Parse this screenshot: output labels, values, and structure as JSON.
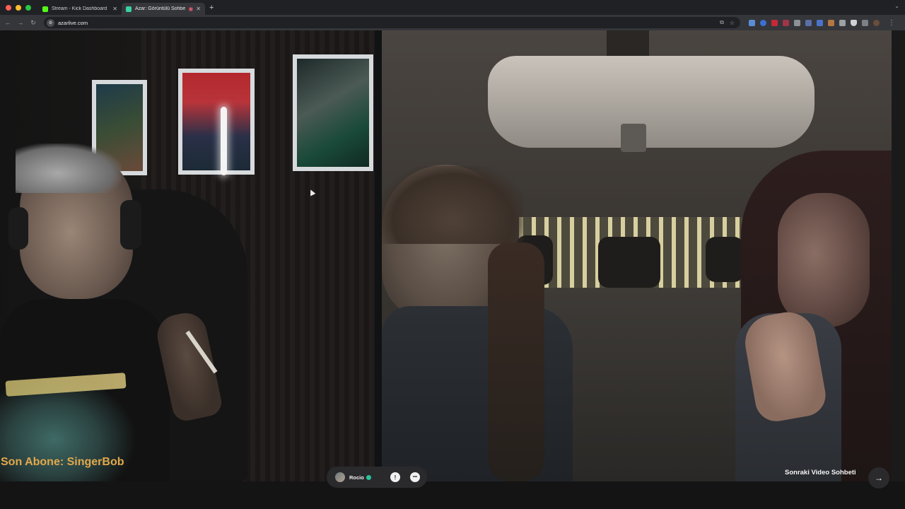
{
  "browser": {
    "tabs": [
      {
        "label": "Stream - Kick Dashboard",
        "favicon_color": "#53fc18"
      },
      {
        "label": "Azar: Görüntülü Sohbet &",
        "favicon_color": "#3ad29f"
      }
    ],
    "url": "azarlive.com"
  },
  "overlay": {
    "last_sub": "Son Abone: SingerBob"
  },
  "chat": {
    "partner_name": "Rocio",
    "report_icon": "!",
    "more_icon": "•••"
  },
  "next_chat": {
    "label": "Sonraki Video Sohbeti",
    "arrow": "→"
  }
}
